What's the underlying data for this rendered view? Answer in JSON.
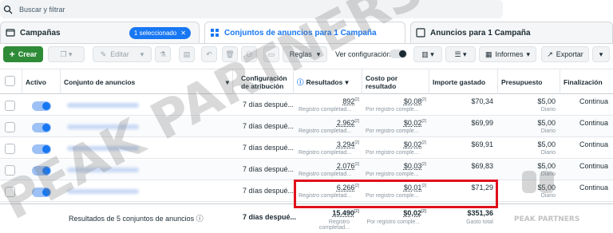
{
  "search": {
    "placeholder": "Buscar y filtrar"
  },
  "tabs": [
    {
      "label": "Campañas",
      "badge": "1 seleccionado"
    },
    {
      "label": "Conjuntos de anuncios para 1 Campaña"
    },
    {
      "label": "Anuncios para 1 Campaña"
    }
  ],
  "toolbar": {
    "create": "Crear",
    "edit": "Editar",
    "rules": "Reglas",
    "view_setting": "Ver configuración",
    "reports": "Informes",
    "export": "Exportar"
  },
  "columns": {
    "active": "Activo",
    "adset": "Conjunto de anuncios",
    "attribution": "Configuración de atribución",
    "results": "Resultados",
    "cost": "Costo por resultado",
    "spent": "Importe gastado",
    "budget": "Presupuesto",
    "end": "Finalización"
  },
  "rows": [
    {
      "attribution": "7 días despué...",
      "results": "892",
      "results_sub": "Registro completad...",
      "cost": "$0,08",
      "cost_sub": "Por registro comple...",
      "spent": "$70,34",
      "budget": "$5,00",
      "budget_sub": "Diario",
      "end": "Continua"
    },
    {
      "attribution": "7 días despué...",
      "results": "2.962",
      "results_sub": "Registro completad...",
      "cost": "$0,02",
      "cost_sub": "Por registro comple...",
      "spent": "$69,99",
      "budget": "$5,00",
      "budget_sub": "Diario",
      "end": "Continua"
    },
    {
      "attribution": "7 días despué...",
      "results": "3.294",
      "results_sub": "Registro completad...",
      "cost": "$0,02",
      "cost_sub": "Por registro comple...",
      "spent": "$69,91",
      "budget": "$5,00",
      "budget_sub": "Diario",
      "end": "Continua"
    },
    {
      "attribution": "7 días despué...",
      "results": "2.076",
      "results_sub": "Registro completad...",
      "cost": "$0,03",
      "cost_sub": "Por registro comple...",
      "spent": "$69,83",
      "budget": "$5,00",
      "budget_sub": "Diario",
      "end": "Continua"
    },
    {
      "attribution": "7 días despué...",
      "results": "6.266",
      "results_sub": "Registro completad...",
      "cost": "$0,01",
      "cost_sub": "Por registro comple...",
      "spent": "$71,29",
      "budget": "$5,00",
      "budget_sub": "Diario",
      "end": "Continua"
    }
  ],
  "sup_mark": "[2]",
  "totals": {
    "label": "Resultados de 5 conjuntos de anuncios",
    "attribution": "7 días despué...",
    "results": "15.490",
    "results_sub": "Registro completad...",
    "cost": "$0,02",
    "cost_sub": "Por registro comple...",
    "spent": "$351,36",
    "spent_sub": "Gasto total"
  },
  "watermark": {
    "text": "PEAK PARTNERS",
    "logo_text": "PEAK PARTNERS"
  },
  "colors": {
    "accent": "#1877f2",
    "create": "#2e8b37",
    "highlight": "#e0101a"
  }
}
